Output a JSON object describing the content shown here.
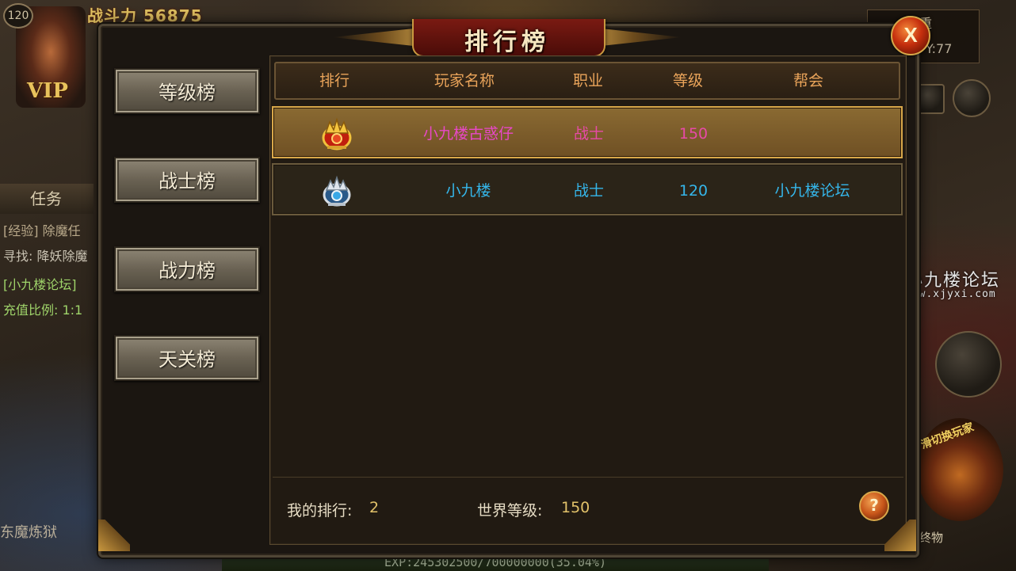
{
  "hud": {
    "level": "120",
    "power": "战斗力 56875",
    "vip": "VIP",
    "coord": "Y:77",
    "top_right_text": "重"
  },
  "task_panel": {
    "tab_label": "任务",
    "lines": [
      "[经验] 除魔任",
      "寻找: 降妖除魔",
      "[小九楼论坛]",
      "充值比例: 1:1"
    ]
  },
  "bottom_left": "东魔炼狱",
  "exp_text": "EXP:245302500/700000000(35.04%)",
  "watermark": {
    "cn": "小九楼论坛",
    "en": "www.xjyxi.com"
  },
  "switch_label": "滑切换玩家",
  "obj_label": "终物",
  "panel": {
    "title": "排行榜",
    "close_label": "X"
  },
  "tabs": [
    {
      "label": "等级榜"
    },
    {
      "label": "战士榜"
    },
    {
      "label": "战力榜"
    },
    {
      "label": "天关榜"
    }
  ],
  "table": {
    "headers": [
      "排行",
      "玩家名称",
      "职业",
      "等级",
      "帮会"
    ],
    "rows": [
      {
        "rank_icon": "gold-crown-icon",
        "name": "小九楼古惑仔",
        "job": "战士",
        "level": "150",
        "guild": ""
      },
      {
        "rank_icon": "silver-crown-icon",
        "name": "小九楼",
        "job": "战士",
        "level": "120",
        "guild": "小九楼论坛"
      }
    ]
  },
  "footer": {
    "my_rank_label": "我的排行:",
    "my_rank_value": "2",
    "world_level_label": "世界等级:",
    "world_level_value": "150",
    "help_label": "?"
  },
  "colors": {
    "header_text": "#eaa45a",
    "row1_text": "#e848c8",
    "row2_text": "#35b6ea",
    "footer_value": "#e2c26a",
    "title_banner": "#7a1a12"
  }
}
